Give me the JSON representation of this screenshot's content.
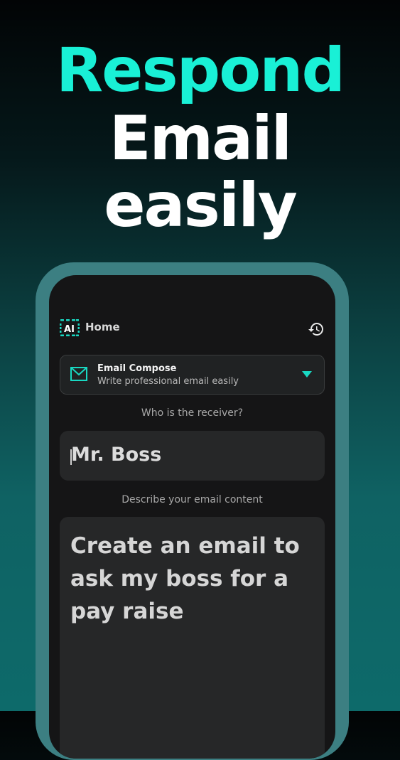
{
  "headline": {
    "line1": "Respond",
    "line2": "Email",
    "line3": "easily"
  },
  "colors": {
    "accent": "#19f0d6",
    "screen_bg": "#151516",
    "card_bg": "#202223",
    "field_bg": "#262728",
    "frame": "#3c7f82"
  },
  "app_bar": {
    "logo_icon": "ai-logo-icon",
    "logo_text": "AI",
    "title": "Home",
    "history_icon": "history-icon"
  },
  "mode_selector": {
    "icon": "mail-icon",
    "title": "Email Compose",
    "subtitle": "Write professional email easily",
    "dropdown_icon": "chevron-down-icon"
  },
  "receiver": {
    "label": "Who is the receiver?",
    "value": "Mr. Boss"
  },
  "content": {
    "label": "Describe your email content",
    "value": "Create an email to ask my boss for a pay raise"
  }
}
